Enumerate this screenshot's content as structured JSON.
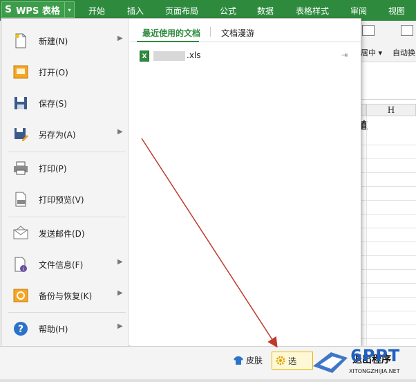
{
  "app": {
    "logo_text": "WPS 表格",
    "logo_glyph": "S",
    "dropdown_glyph": "▾"
  },
  "ribbon_tabs": [
    "开始",
    "插入",
    "页面布局",
    "公式",
    "数据",
    "表格样式",
    "审阅",
    "视图"
  ],
  "toolbar": {
    "merge_center_label": "居中 ▾",
    "auto_wrap_label": "自动换"
  },
  "sheet": {
    "col_h": "H",
    "partial_char": "值"
  },
  "file_menu": {
    "items": [
      {
        "label": "新建(N)",
        "icon": "new-document-icon",
        "has_submenu": true
      },
      {
        "label": "打开(O)",
        "icon": "open-folder-icon",
        "has_submenu": false
      },
      {
        "label": "保存(S)",
        "icon": "save-disk-icon",
        "has_submenu": false
      },
      {
        "label": "另存为(A)",
        "icon": "save-as-icon",
        "has_submenu": true
      },
      {
        "label": "打印(P)",
        "icon": "printer-icon",
        "has_submenu": false
      },
      {
        "label": "打印预览(V)",
        "icon": "print-preview-icon",
        "has_submenu": false
      },
      {
        "label": "发送邮件(D)",
        "icon": "envelope-icon",
        "has_submenu": false
      },
      {
        "label": "文件信息(F)",
        "icon": "file-info-icon",
        "has_submenu": true
      },
      {
        "label": "备份与恢复(K)",
        "icon": "backup-restore-icon",
        "has_submenu": true
      },
      {
        "label": "帮助(H)",
        "icon": "help-icon",
        "has_submenu": true
      }
    ],
    "submenu_arrow": "▶"
  },
  "recent": {
    "tab_recent": "最近使用的文档",
    "tab_roam": "文档漫游",
    "file_ext": ".xls",
    "xls_icon_text": "X",
    "pin_glyph": "⇥"
  },
  "footer": {
    "skin_label": "皮肤",
    "options_label": "选",
    "exit_label": "退出程序"
  },
  "watermark": {
    "text": "6PPT",
    "sub": "XITONGZHIJIA.NET"
  },
  "colors": {
    "ribbon_green": "#2e8b3e",
    "annotation_arrow": "#c0392b",
    "options_highlight": "#e6b800"
  }
}
